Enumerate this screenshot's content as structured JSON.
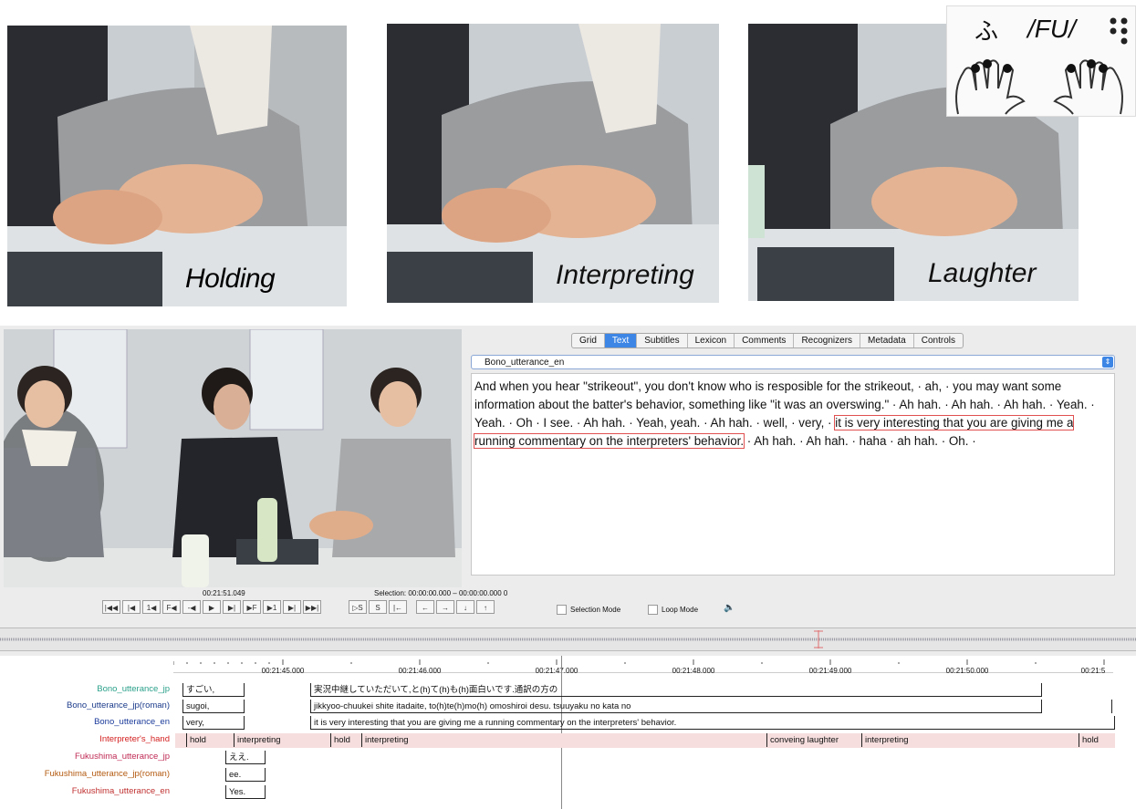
{
  "photos": {
    "captions": [
      "Holding",
      "Interpreting",
      "Laughter"
    ]
  },
  "braille": {
    "character": "ふ",
    "romaji": "/FU/"
  },
  "elan": {
    "tabs": [
      "Grid",
      "Text",
      "Subtitles",
      "Lexicon",
      "Comments",
      "Recognizers",
      "Metadata",
      "Controls"
    ],
    "active_tab": "Text",
    "tier_selected": "Bono_utterance_en",
    "transcript_before": "And when you hear \"strikeout\", you don't know who is resposible for the strikeout, · ah, · you may want some information about the batter's behavior, something like \"it was an overswing.\" · Ah hah. · Ah hah. · Ah hah. · Yeah. · Yeah. · Oh · I see. · Ah hah. · Yeah, yeah. · Ah hah. · well, · very, · ",
    "transcript_highlight": "it is very interesting that you are giving me a running commentary on the interpreters' behavior.",
    "transcript_after": " · Ah hah. · Ah hah. · haha · ah hah. · Oh. ·",
    "media_time": "00:21:51.049",
    "selection": "Selection: 00:00:00.000 – 00:00:00.000  0",
    "player_buttons": [
      "|◀◀",
      "|◀",
      "1◀",
      "F◀",
      "-◀",
      "▶",
      "▶|",
      "▶F",
      "▶1",
      "▶|",
      "▶▶|"
    ],
    "selection_buttons": [
      "▷S",
      "S",
      "|←"
    ],
    "nav_buttons": [
      "←",
      "→",
      "↓",
      "↑"
    ],
    "selection_mode": "Selection Mode",
    "loop_mode": "Loop Mode",
    "ruler_ticks": [
      "00:21:45.000",
      "00:21:46.000",
      "00:21:47.000",
      "00:21:48.000",
      "00:21:49.000",
      "00:21:50.000",
      "00:21:5"
    ],
    "tiers": [
      {
        "name": "Bono_utterance_jp",
        "color": "#2aa08a",
        "segments": [
          {
            "text": "すごい,"
          },
          {
            "text": "実況中継していただいて,と(h)て(h)も(h)面白いです.通訳の方の"
          }
        ]
      },
      {
        "name": "Bono_utterance_jp(roman)",
        "color": "#1a3a8a",
        "segments": [
          {
            "text": "sugoi,"
          },
          {
            "text": "jikkyoo-chuukei shite itadaite, to(h)te(h)mo(h) omoshiroi desu. tsuuyaku no kata no"
          }
        ]
      },
      {
        "name": "Bono_utterance_en",
        "color": "#1a3a9a",
        "segments": [
          {
            "text": "very,"
          },
          {
            "text": "it is very interesting that you are giving me a running commentary on the interpreters' behavior."
          }
        ]
      },
      {
        "name": "Interpreter's_hand",
        "color": "#d42020",
        "segments": [
          {
            "text": "hold"
          },
          {
            "text": "interpreting"
          },
          {
            "text": "hold"
          },
          {
            "text": "interpreting"
          },
          {
            "text": "conveing laughter"
          },
          {
            "text": "interpreting"
          },
          {
            "text": "hold"
          }
        ]
      },
      {
        "name": "Fukushima_utterance_jp",
        "color": "#c02a55",
        "segments": [
          {
            "text": "ええ."
          }
        ]
      },
      {
        "name": "Fukushima_utterance_jp(roman)",
        "color": "#b35a10",
        "segments": [
          {
            "text": "ee."
          }
        ]
      },
      {
        "name": "Fukushima_utterance_en",
        "color": "#c03030",
        "segments": [
          {
            "text": "Yes."
          }
        ]
      }
    ]
  }
}
